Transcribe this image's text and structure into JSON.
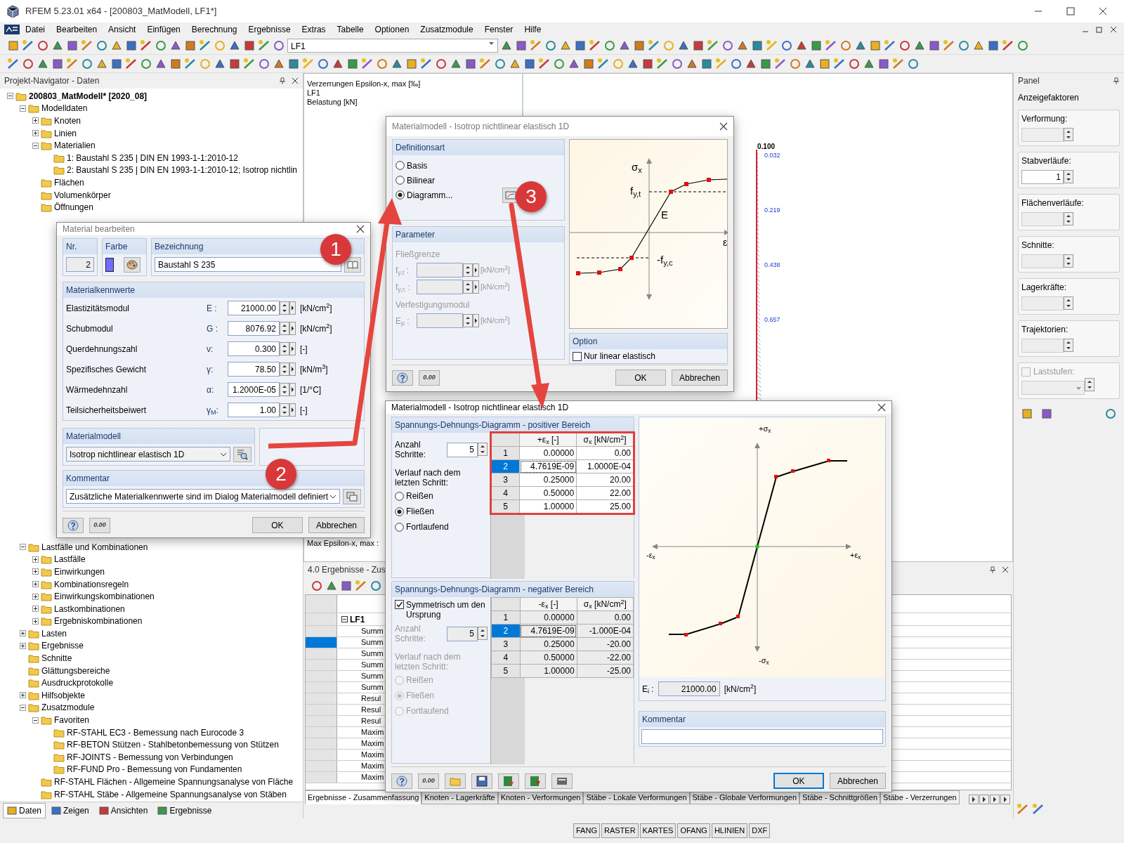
{
  "window": {
    "title": "RFEM 5.23.01 x64 - [200803_MatModell, LF1*]"
  },
  "menu": [
    "Datei",
    "Bearbeiten",
    "Ansicht",
    "Einfügen",
    "Berechnung",
    "Ergebnisse",
    "Extras",
    "Tabelle",
    "Optionen",
    "Zusatzmodule",
    "Fenster",
    "Hilfe"
  ],
  "toolbar": {
    "load_case": "LF1"
  },
  "navigator": {
    "title": "Projekt-Navigator - Daten",
    "tree": [
      {
        "label": "200803_MatModell* [2020_08]",
        "expanded": true,
        "children": [
          {
            "label": "Modelldaten",
            "expanded": true,
            "children": [
              {
                "label": "Knoten",
                "expanded": false
              },
              {
                "label": "Linien",
                "expanded": false
              },
              {
                "label": "Materialien",
                "expanded": true,
                "children": [
                  {
                    "label": "1: Baustahl S 235 | DIN EN 1993-1-1:2010-12"
                  },
                  {
                    "label": "2: Baustahl S 235 | DIN EN 1993-1-1:2010-12; Isotrop nichtlin"
                  }
                ]
              },
              {
                "label": "Flächen"
              },
              {
                "label": "Volumenkörper"
              },
              {
                "label": "Öffnungen"
              }
            ]
          },
          {
            "label": "Lastfälle und Kombinationen",
            "expanded": true,
            "children": [
              {
                "label": "Lastfälle",
                "expanded": false
              },
              {
                "label": "Einwirkungen",
                "expanded": false
              },
              {
                "label": "Kombinationsregeln",
                "expanded": false
              },
              {
                "label": "Einwirkungskombinationen",
                "expanded": false
              },
              {
                "label": "Lastkombinationen",
                "expanded": false
              },
              {
                "label": "Ergebniskombinationen",
                "expanded": false
              }
            ]
          },
          {
            "label": "Lasten",
            "expanded": false
          },
          {
            "label": "Ergebnisse",
            "expanded": false
          },
          {
            "label": "Schnitte"
          },
          {
            "label": "Glättungsbereiche"
          },
          {
            "label": "Ausdruckprotokolle"
          },
          {
            "label": "Hilfsobjekte",
            "expanded": false
          },
          {
            "label": "Zusatzmodule",
            "expanded": true,
            "children": [
              {
                "label": "Favoriten",
                "expanded": true,
                "children": [
                  {
                    "label": "RF-STAHL EC3 - Bemessung nach Eurocode 3"
                  },
                  {
                    "label": "RF-BETON Stützen - Stahlbetonbemessung von Stützen"
                  },
                  {
                    "label": "RF-JOINTS - Bemessung von Verbindungen"
                  },
                  {
                    "label": "RF-FUND Pro - Bemessung von Fundamenten"
                  }
                ]
              },
              {
                "label": "RF-STAHL Flächen - Allgemeine Spannungsanalyse von Fläche"
              },
              {
                "label": "RF-STAHL Stäbe - Allgemeine Spannungsanalyse von Stäben"
              }
            ]
          }
        ]
      }
    ],
    "tabs": [
      {
        "label": "Daten",
        "selected": true
      },
      {
        "label": "Zeigen",
        "selected": false
      },
      {
        "label": "Ansichten",
        "selected": false
      },
      {
        "label": "Ergebnisse",
        "selected": false
      }
    ]
  },
  "view": {
    "lines": [
      "Verzerrungen Epsilon-x, max  [‰]",
      "LF1",
      "Belastung [kN]"
    ],
    "footer": "Max Epsilon-x, max :",
    "top_value": "0.100",
    "values": [
      "0.032",
      "0.219",
      "0.438",
      "0.657"
    ]
  },
  "panel": {
    "title": "Panel",
    "section": "Anzeigefaktoren",
    "fields": [
      {
        "kind": "spin",
        "label": "Verformung:",
        "disabled": true
      },
      {
        "kind": "spin",
        "label": "Stabverläufe:",
        "value": "1",
        "disabled": false
      },
      {
        "kind": "spin",
        "label": "Flächenverläufe:",
        "disabled": true
      },
      {
        "kind": "spin",
        "label": "Schnitte:",
        "disabled": true
      },
      {
        "kind": "spin",
        "label": "Lagerkräfte:",
        "disabled": true
      },
      {
        "kind": "spin",
        "label": "Trajektorien:",
        "disabled": true
      },
      {
        "kind": "check",
        "label": "Laststufen:",
        "checked": false,
        "disabled": true
      }
    ]
  },
  "results": {
    "title": "4.0 Ergebnisse - Zus",
    "group": "LF1",
    "rows": [
      {
        "label": "Summ",
        "selected": false
      },
      {
        "label": "Summ",
        "selected": true
      },
      {
        "label": "Summ",
        "selected": false
      },
      {
        "label": "Summ",
        "selected": false
      },
      {
        "label": "Summ",
        "selected": false
      },
      {
        "label": "Summ",
        "selected": false
      },
      {
        "label": "Resul",
        "selected": false
      },
      {
        "label": "Resul",
        "selected": false
      },
      {
        "label": "Resul",
        "selected": false
      },
      {
        "label": "Maxim",
        "selected": false
      },
      {
        "label": "Maxim",
        "selected": false
      },
      {
        "label": "Maxim",
        "selected": false
      },
      {
        "label": "Maxim",
        "selected": false
      },
      {
        "label": "Maxim",
        "selected": false
      }
    ],
    "tabs": [
      {
        "label": "Ergebnisse - Zusammenfassung",
        "selected": true
      },
      {
        "label": "Knoten - Lagerkräfte",
        "selected": false
      },
      {
        "label": "Knoten - Verformungen",
        "selected": false
      },
      {
        "label": "Stäbe - Lokale Verformungen",
        "selected": false
      },
      {
        "label": "Stäbe - Globale Verformungen",
        "selected": false
      },
      {
        "label": "Stäbe - Schnittgrößen",
        "selected": false
      },
      {
        "label": "Stäbe - Verzerrungen",
        "selected": false
      }
    ]
  },
  "status_bar": [
    "FANG",
    "RASTER",
    "KARTES",
    "OFANG",
    "HLINIEN",
    "DXF"
  ],
  "material_dialog": {
    "title": "Material bearbeiten",
    "nr_label": "Nr.",
    "nr": "2",
    "color_label": "Farbe",
    "color": "#6f6cff",
    "name_label": "Bezeichnung",
    "name": "Baustahl S 235",
    "props_title": "Materialkennwerte",
    "props": [
      {
        "label": "Elastizitätsmodul",
        "symbol": "E :",
        "value": "21000.00",
        "unit": "[kN/cm$^{2}$]"
      },
      {
        "label": "Schubmodul",
        "symbol": "G :",
        "value": "8076.92",
        "unit": "[kN/cm$^{2}$]"
      },
      {
        "label": "Querdehnungszahl",
        "symbol": "ν:",
        "value": "0.300",
        "unit": "[-]"
      },
      {
        "label": "Spezifisches Gewicht",
        "symbol": "γ:",
        "value": "78.50",
        "unit": "[kN/m$^{3}$]"
      },
      {
        "label": "Wärmedehnzahl",
        "symbol": "α:",
        "value": "1.2000E-05",
        "unit": "[1/°C]"
      },
      {
        "label": "Teilsicherheitsbeiwert",
        "symbol": "γ$_{M}$:",
        "value": "1.00",
        "unit": "[-]"
      }
    ],
    "model_title": "Materialmodell",
    "model": "Isotrop nichtlinear elastisch 1D",
    "comment_title": "Kommentar",
    "comment": "Zusätzliche Materialkennwerte sind im Dialog Materialmodell definiert",
    "decimal_icon": "0.00",
    "buttons": [
      "OK",
      "Abbrechen"
    ]
  },
  "model_dialog": {
    "title": "Materialmodell - Isotrop nichtlinear elastisch 1D",
    "def_title": "Definitionsart",
    "options": [
      {
        "label": "Basis",
        "selected": false
      },
      {
        "label": "Bilinear",
        "selected": false
      },
      {
        "label": "Diagramm...",
        "selected": true
      }
    ],
    "param_title": "Parameter",
    "param_disabled": true,
    "params": [
      {
        "group": "Fließgrenze",
        "symbol": "f$_{y,t}$ :",
        "unit": "[kN/cm$^{2}$]"
      },
      {
        "symbol": "f$_{y,c}$ :",
        "unit": "[kN/cm$^{2}$]"
      },
      {
        "group": "Verfestigungsmodul",
        "symbol": "E$_{p}$ :",
        "unit": "[kN/cm$^{2}$]"
      }
    ],
    "preview_labels": {
      "sigma": "σ$_{x}$",
      "fyt": "f$_{y,t}$",
      "e": "E",
      "fyc": "-f$_{y,c}$",
      "eps": "ε"
    },
    "option_title": "Option",
    "option": {
      "label": "Nur linear elastisch",
      "checked": false
    },
    "decimal_icon": "0.00",
    "buttons": [
      "OK",
      "Abbrechen"
    ]
  },
  "diagram_dialog": {
    "title": "Materialmodell - Isotrop nichtlinear elastisch 1D",
    "positive": {
      "title": "Spannungs-Dehnungs-Diagramm - positiver Bereich",
      "steps_label": "Anzahl Schritte:",
      "steps": "5",
      "after_label": "Verlauf nach dem letzten Schritt:",
      "disabled": false,
      "options": [
        {
          "label": "Reißen",
          "selected": false
        },
        {
          "label": "Fließen",
          "selected": true
        },
        {
          "label": "Fortlaufend",
          "selected": false
        }
      ],
      "columns": [
        "+ε$_{x}$ [-]",
        "σ$_{x}$ [kN/cm$^{2}$]"
      ],
      "rows": [
        {
          "no": "1",
          "eps": "0.00000",
          "sigma": "0.00",
          "selected": false
        },
        {
          "no": "2",
          "eps": "4.7619E-09",
          "sigma": "1.0000E-04",
          "selected": true
        },
        {
          "no": "3",
          "eps": "0.25000",
          "sigma": "20.00",
          "selected": false
        },
        {
          "no": "4",
          "eps": "0.50000",
          "sigma": "22.00",
          "selected": false
        },
        {
          "no": "5",
          "eps": "1.00000",
          "sigma": "25.00",
          "selected": false
        }
      ]
    },
    "negative": {
      "title": "Spannungs-Dehnungs-Diagramm - negativer Bereich",
      "symmetric": {
        "label": "Symmetrisch um den Ursprung",
        "checked": true
      },
      "steps_label": "Anzahl Schritte:",
      "steps": "5",
      "after_label": "Verlauf nach dem letzten Schritt:",
      "disabled": true,
      "options": [
        {
          "label": "Reißen",
          "selected": false
        },
        {
          "label": "Fließen",
          "selected": true
        },
        {
          "label": "Fortlaufend",
          "selected": false
        }
      ],
      "columns": [
        "-ε$_{x}$ [-]",
        "σ$_{x}$ [kN/cm$^{2}$]"
      ],
      "rows": [
        {
          "no": "1",
          "eps": "0.00000",
          "sigma": "0.00",
          "selected": false
        },
        {
          "no": "2",
          "eps": "4.7619E-09",
          "sigma": "-1.000E-04",
          "selected": true
        },
        {
          "no": "3",
          "eps": "0.25000",
          "sigma": "-20.00",
          "selected": false
        },
        {
          "no": "4",
          "eps": "0.50000",
          "sigma": "-22.00",
          "selected": false
        },
        {
          "no": "5",
          "eps": "1.00000",
          "sigma": "-25.00",
          "selected": false
        }
      ]
    },
    "axis_labels": {
      "top": "+σ$_{x}$",
      "left": "-ε$_{x}$",
      "right": "+ε$_{x}$",
      "bottom": "-σ$_{x}$"
    },
    "ei_label": "E$_{i}$ :",
    "ei": "21000.00",
    "ei_unit": "[kN/cm$^{2}$]",
    "comment_title": "Kommentar",
    "decimal_icon": "0.00",
    "buttons": [
      "OK",
      "Abbrechen"
    ]
  },
  "annotations": [
    "1",
    "2",
    "3"
  ]
}
